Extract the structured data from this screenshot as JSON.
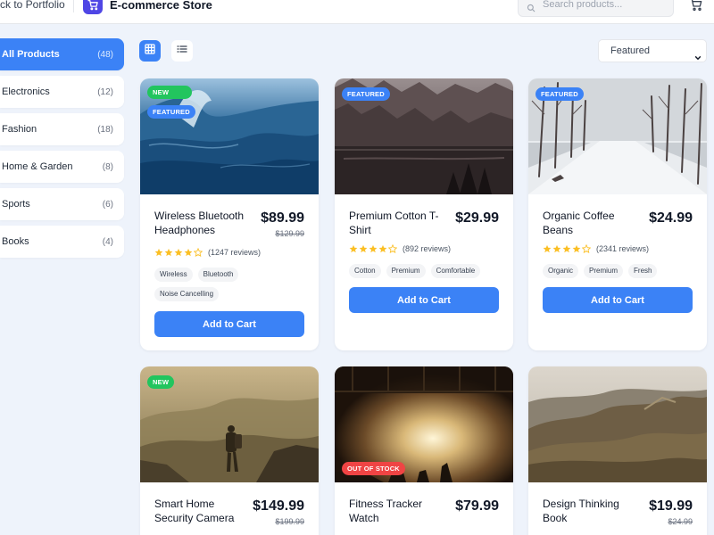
{
  "header": {
    "back_link": "ck to Portfolio",
    "store_title": "E-commerce Store",
    "search_placeholder": "Search products...",
    "brand_color": "#4f46e5"
  },
  "sidebar": {
    "categories": [
      {
        "label": "All Products",
        "count": "(48)",
        "active": true
      },
      {
        "label": "Electronics",
        "count": "(12)",
        "active": false
      },
      {
        "label": "Fashion",
        "count": "(18)",
        "active": false
      },
      {
        "label": "Home & Garden",
        "count": "(8)",
        "active": false
      },
      {
        "label": "Sports",
        "count": "(6)",
        "active": false
      },
      {
        "label": "Books",
        "count": "(4)",
        "active": false
      }
    ]
  },
  "toolbar": {
    "view_mode": "grid",
    "sort_selected": "Featured"
  },
  "products": [
    {
      "name": "Wireless Bluetooth Headphones",
      "price": "$89.99",
      "original_price": "$129.99",
      "rating": 4.5,
      "reviews": "(1247 reviews)",
      "tags": [
        "Wireless",
        "Bluetooth",
        "Noise Cancelling"
      ],
      "badges": [
        "NEW",
        "FEATURED"
      ],
      "button": "Add to Cart",
      "image_theme": "ocean-wave"
    },
    {
      "name": "Premium Cotton T-Shirt",
      "price": "$29.99",
      "original_price": "",
      "rating": 4,
      "reviews": "(892 reviews)",
      "tags": [
        "Cotton",
        "Premium",
        "Comfortable"
      ],
      "badges": [
        "FEATURED"
      ],
      "button": "Add to Cart",
      "image_theme": "forest-lake"
    },
    {
      "name": "Organic Coffee Beans",
      "price": "$24.99",
      "original_price": "",
      "rating": 4,
      "reviews": "(2341 reviews)",
      "tags": [
        "Organic",
        "Premium",
        "Fresh"
      ],
      "badges": [
        "FEATURED"
      ],
      "button": "Add to Cart",
      "image_theme": "snowy-road"
    },
    {
      "name": "Smart Home Security Camera",
      "price": "$149.99",
      "original_price": "$199.99",
      "badges": [
        "NEW"
      ],
      "image_theme": "hiker-mountains"
    },
    {
      "name": "Fitness Tracker Watch",
      "price": "$79.99",
      "original_price": "",
      "badges": [
        "OUT OF STOCK"
      ],
      "image_theme": "concert-stage"
    },
    {
      "name": "Design Thinking Book",
      "price": "$19.99",
      "original_price": "$24.99",
      "badges": [],
      "image_theme": "mountain-valley"
    }
  ],
  "colors": {
    "accent": "#3b82f6",
    "new_badge": "#22c55e",
    "out_of_stock_badge": "#ef4444",
    "star": "#fbbf24"
  }
}
